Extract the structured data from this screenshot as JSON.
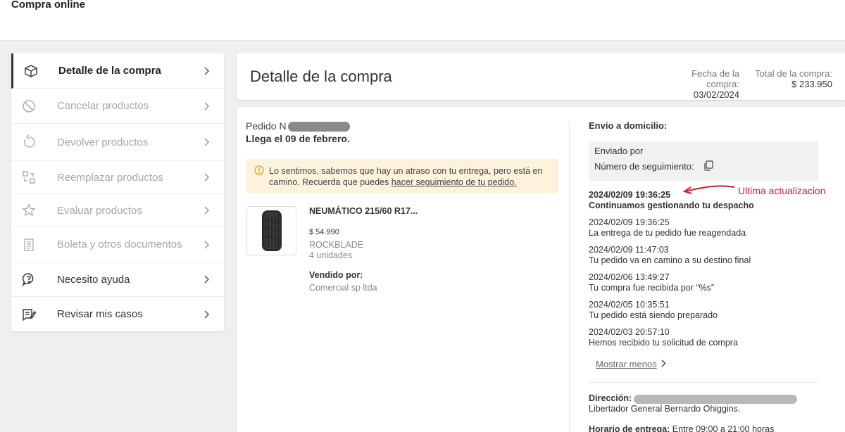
{
  "app": {
    "title": "Compra online"
  },
  "sidebar": {
    "items": [
      {
        "label": "Detalle de la compra",
        "icon": "box-icon",
        "state": "active"
      },
      {
        "label": "Cancelar productos",
        "icon": "cancel-icon",
        "state": "disabled"
      },
      {
        "label": "Devolver productos",
        "icon": "return-icon",
        "state": "disabled"
      },
      {
        "label": "Reemplazar productos",
        "icon": "replace-icon",
        "state": "disabled"
      },
      {
        "label": "Evaluar productos",
        "icon": "star-icon",
        "state": "disabled"
      },
      {
        "label": "Boleta y otros documentos",
        "icon": "document-icon",
        "state": "disabled"
      },
      {
        "label": "Necesito ayuda",
        "icon": "help-icon",
        "state": "enabled"
      },
      {
        "label": "Revisar mis casos",
        "icon": "cases-icon",
        "state": "enabled"
      }
    ]
  },
  "header": {
    "title": "Detalle de la compra",
    "purchase_date_label": "Fecha de la compra:",
    "purchase_date": "03/02/2024",
    "total_label": "Total de la compra:",
    "total": "$ 233.950"
  },
  "order": {
    "number_label": "Pedido N",
    "arrival": "Llega el 09 de febrero.",
    "alert_text": "Lo sentimos, sabemos que hay un atraso con tu entrega, pero está en camino. Recuerda que puedes ",
    "alert_link": "hacer seguimiento de tu pedido."
  },
  "product": {
    "name": "NEUMÁTICO 215/60 R17...",
    "price": "$ 54.990",
    "brand": "ROCKBLADE",
    "units": "4 unidades",
    "sold_by_label": "Vendido por:",
    "seller": "Comercial sp ltda"
  },
  "shipping": {
    "title": "Envío a domicilio:",
    "sent_by_label": "Enviado por",
    "tracking_label": "Número de seguimiento:",
    "events": [
      {
        "date": "2024/02/09 19:36:25",
        "status": "Continuamos gestionando tu despacho"
      },
      {
        "date": "2024/02/09 19:36:25",
        "status": "La entrega de tu pedido fue reagendada"
      },
      {
        "date": "2024/02/09 11:47:03",
        "status": "Tu pedido va en camino a su destino final"
      },
      {
        "date": "2024/02/06 13:49:27",
        "status": "Tu compra fue recibida por “%s”"
      },
      {
        "date": "2024/02/05 10:35:51",
        "status": "Tu pedido está siendo preparado"
      },
      {
        "date": "2024/02/03 20:57:10",
        "status": "Hemos recibido tu solicitud de compra"
      }
    ],
    "show_less": "Mostrar menos",
    "address_label": "Dirección:",
    "address_line2": "Libertador General Bernardo Ohiggins.",
    "hours_label": "Horario de entrega:",
    "hours_value": "Entre 09:00 a 21:00 horas"
  },
  "annotation": {
    "text": "Ultima actualizacion",
    "color": "#d0202a"
  }
}
